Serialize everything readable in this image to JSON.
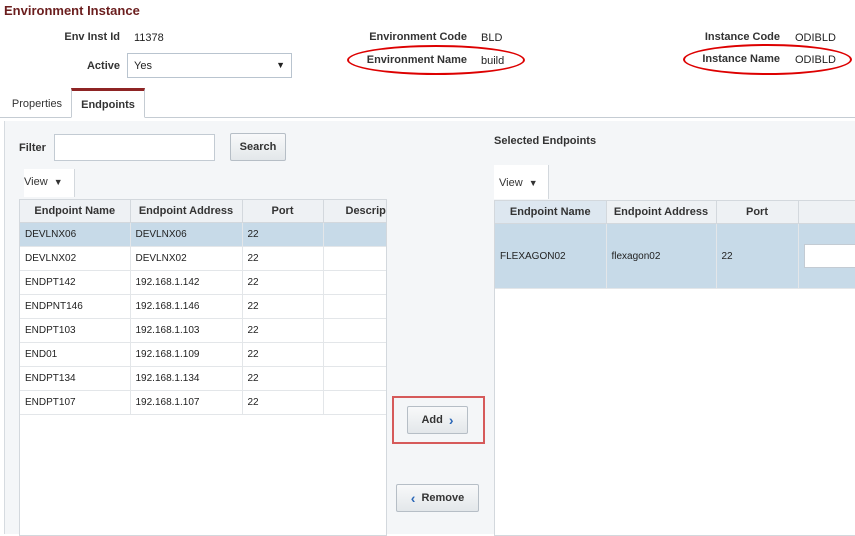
{
  "header": {
    "title": "Environment Instance"
  },
  "fields": {
    "env_inst_id_label": "Env Inst Id",
    "env_inst_id_value": "11378",
    "active_label": "Active",
    "active_value": "Yes",
    "env_code_label": "Environment Code",
    "env_code_value": "BLD",
    "env_name_label": "Environment Name",
    "env_name_value": "build",
    "inst_code_label": "Instance Code",
    "inst_code_value": "ODIBLD",
    "inst_name_label": "Instance Name",
    "inst_name_value": "ODIBLD"
  },
  "tabs": [
    {
      "label": "Properties",
      "active": false
    },
    {
      "label": "Endpoints",
      "active": true
    }
  ],
  "left": {
    "filter_label": "Filter",
    "filter_value": "",
    "search_label": "Search",
    "view_label": "View",
    "columns": [
      "Endpoint Name",
      "Endpoint Address",
      "Port",
      "Descrip"
    ],
    "rows": [
      {
        "name": "DEVLNX06",
        "address": "DEVLNX06",
        "port": "22",
        "selected": true
      },
      {
        "name": "DEVLNX02",
        "address": "DEVLNX02",
        "port": "22",
        "selected": false
      },
      {
        "name": "ENDPT142",
        "address": "192.168.1.142",
        "port": "22",
        "selected": false
      },
      {
        "name": "ENDPNT146",
        "address": "192.168.1.146",
        "port": "22",
        "selected": false
      },
      {
        "name": "ENDPT103",
        "address": "192.168.1.103",
        "port": "22",
        "selected": false
      },
      {
        "name": "END01",
        "address": "192.168.1.109",
        "port": "22",
        "selected": false
      },
      {
        "name": "ENDPT134",
        "address": "192.168.1.134",
        "port": "22",
        "selected": false
      },
      {
        "name": "ENDPT107",
        "address": "192.168.1.107",
        "port": "22",
        "selected": false
      }
    ]
  },
  "actions": {
    "add_label": "Add",
    "remove_label": "Remove"
  },
  "right": {
    "title": "Selected Endpoints",
    "view_label": "View",
    "columns": [
      "Endpoint Name",
      "Endpoint Address",
      "Port",
      ""
    ],
    "rows": [
      {
        "name": "FLEXAGON02",
        "address": "flexagon02",
        "port": "22",
        "selected": true
      }
    ]
  },
  "colors": {
    "title": "#6b1e1e",
    "tab_accent": "#8e2424",
    "selected_row": "#c7dae8",
    "highlight_red": "#d00000"
  }
}
